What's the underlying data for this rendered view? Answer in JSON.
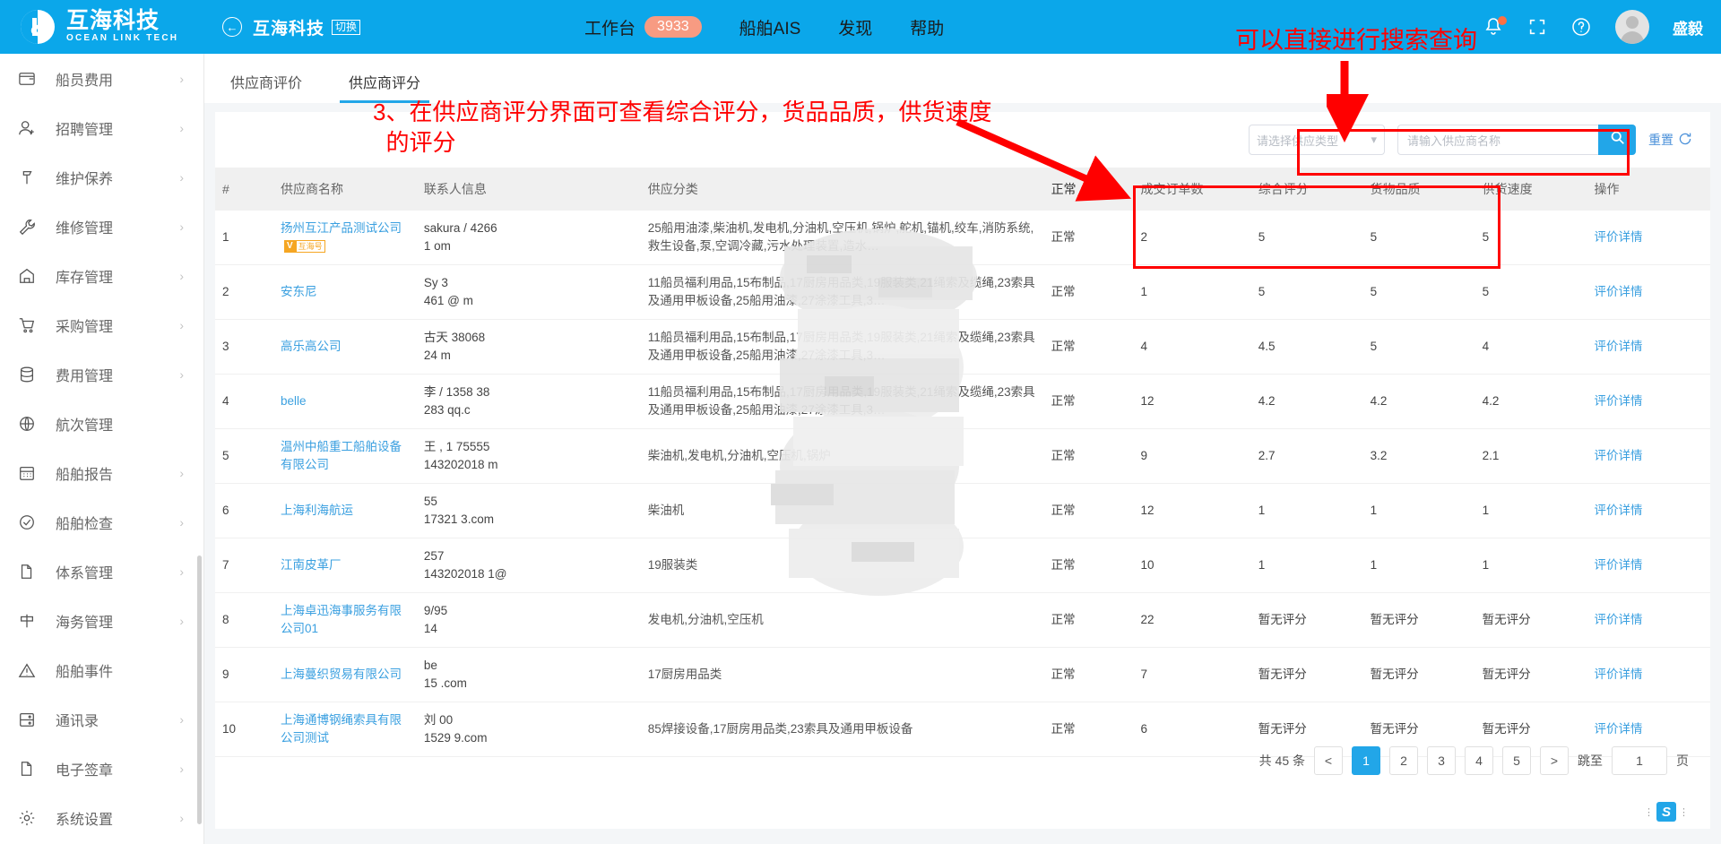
{
  "brand": {
    "cn": "互海科技",
    "en": "OCEAN LINK TECH",
    "sub_title": "互海科技",
    "switch_label": "切换"
  },
  "topnav": {
    "items": [
      {
        "label": "工作台",
        "badge": "3933"
      },
      {
        "label": "船舶AIS",
        "badge": ""
      },
      {
        "label": "发现",
        "badge": ""
      },
      {
        "label": "帮助",
        "badge": ""
      }
    ],
    "username": "盛毅"
  },
  "sidebar": {
    "items": [
      {
        "label": "船员费用",
        "icon": "wallet-icon",
        "arrow": "›"
      },
      {
        "label": "招聘管理",
        "icon": "user-plus-icon",
        "arrow": "›"
      },
      {
        "label": "维护保养",
        "icon": "hammer-icon",
        "arrow": "›"
      },
      {
        "label": "维修管理",
        "icon": "wrench-icon",
        "arrow": "›"
      },
      {
        "label": "库存管理",
        "icon": "home-icon",
        "arrow": "›"
      },
      {
        "label": "采购管理",
        "icon": "cart-icon",
        "arrow": "›"
      },
      {
        "label": "费用管理",
        "icon": "database-icon",
        "arrow": "›"
      },
      {
        "label": "航次管理",
        "icon": "globe-icon",
        "arrow": ""
      },
      {
        "label": "船舶报告",
        "icon": "calendar-icon",
        "arrow": "›"
      },
      {
        "label": "船舶检查",
        "icon": "check-circle-icon",
        "arrow": "›"
      },
      {
        "label": "体系管理",
        "icon": "doc-copy-icon",
        "arrow": "›"
      },
      {
        "label": "海务管理",
        "icon": "signpost-icon",
        "arrow": "›"
      },
      {
        "label": "船舶事件",
        "icon": "warning-icon",
        "arrow": ""
      },
      {
        "label": "通讯录",
        "icon": "contacts-icon",
        "arrow": "›"
      },
      {
        "label": "电子签章",
        "icon": "stamp-doc-icon",
        "arrow": "›"
      },
      {
        "label": "系统设置",
        "icon": "gear-icon",
        "arrow": "›"
      }
    ]
  },
  "tabs": [
    {
      "label": "供应商评价",
      "active": false
    },
    {
      "label": "供应商评分",
      "active": true
    }
  ],
  "filters": {
    "type_placeholder": "请选择供应类型",
    "name_placeholder": "请输入供应商名称",
    "search_icon": "search-icon",
    "reset_label": "重置",
    "reset_icon": "refresh-icon"
  },
  "table": {
    "headers": [
      "#",
      "供应商名称",
      "联系人信息",
      "供应分类",
      "正常",
      "成交订单数",
      "综合评分",
      "货物品质",
      "供货速度",
      "操作"
    ],
    "status_sort_glyph": "▼",
    "rows": [
      {
        "idx": "1",
        "name": "扬州互江产品测试公司",
        "badge_v": "V",
        "badge_text": "互海号",
        "contact_line1": "sakura /          4266",
        "contact_line2": "1                om",
        "category": "25船用油漆,柴油机,发电机,分油机,空压机,锅炉,舵机,锚机,绞车,消防系统,救生设备,泵,空调冷藏,污水处理装置,造水…",
        "status": "正常",
        "orders": "2",
        "overall": "5",
        "quality": "5",
        "speed": "5",
        "action": "评价详情"
      },
      {
        "idx": "2",
        "name": "安东尼",
        "badge_v": "",
        "badge_text": "",
        "contact_line1": "Sy                 3",
        "contact_line2": "461          @     m",
        "category": "11船员福利用品,15布制品,17厨房用品类,19服装类,21绳索及缆绳,23索具及通用甲板设备,25船用油漆,27涂漆工具,3…",
        "status": "正常",
        "orders": "1",
        "overall": "5",
        "quality": "5",
        "speed": "5",
        "action": "评价详情"
      },
      {
        "idx": "3",
        "name": "高乐高公司",
        "badge_v": "",
        "badge_text": "",
        "contact_line1": "古天          38068",
        "contact_line2": "24              m",
        "category": "11船员福利用品,15布制品,17厨房用品类,19服装类,21绳索及缆绳,23索具及通用甲板设备,25船用油漆,27涂漆工具,3…",
        "status": "正常",
        "orders": "4",
        "overall": "4.5",
        "quality": "5",
        "speed": "4",
        "action": "评价详情"
      },
      {
        "idx": "4",
        "name": "belle",
        "badge_v": "",
        "badge_text": "",
        "contact_line1": "李      / 1358      38",
        "contact_line2": "283      qq.c",
        "category": "11船员福利用品,15布制品,17厨房用品类,19服装类,21绳索及缆绳,23索具及通用甲板设备,25船用油漆,27涂漆工具,3…",
        "status": "正常",
        "orders": "12",
        "overall": "4.2",
        "quality": "4.2",
        "speed": "4.2",
        "action": "评价详情"
      },
      {
        "idx": "5",
        "name": "温州中船重工船舶设备有限公司",
        "badge_v": "",
        "badge_text": "",
        "contact_line1": "王      , 1     75555",
        "contact_line2": "143202018        m",
        "category": "柴油机,发电机,分油机,空压机,锅炉",
        "status": "正常",
        "orders": "9",
        "overall": "2.7",
        "quality": "3.2",
        "speed": "2.1",
        "action": "评价详情"
      },
      {
        "idx": "6",
        "name": "上海利海航运",
        "badge_v": "",
        "badge_text": "",
        "contact_line1": "                   55",
        "contact_line2": "17321            3.com",
        "category": "柴油机",
        "status": "正常",
        "orders": "12",
        "overall": "1",
        "quality": "1",
        "speed": "1",
        "action": "评价详情"
      },
      {
        "idx": "7",
        "name": "江南皮革厂",
        "badge_v": "",
        "badge_text": "",
        "contact_line1": "                   257",
        "contact_line2": "143202018 1@",
        "category": "19服装类",
        "status": "正常",
        "orders": "10",
        "overall": "1",
        "quality": "1",
        "speed": "1",
        "action": "评价详情"
      },
      {
        "idx": "8",
        "name": "上海卓迅海事服务有限公司01",
        "badge_v": "",
        "badge_text": "",
        "contact_line1": "                 9/95",
        "contact_line2": "14",
        "category": "发电机,分油机,空压机",
        "status": "正常",
        "orders": "22",
        "overall": "暂无评分",
        "quality": "暂无评分",
        "speed": "暂无评分",
        "action": "评价详情"
      },
      {
        "idx": "9",
        "name": "上海蔓织贸易有限公司",
        "badge_v": "",
        "badge_text": "",
        "contact_line1": "be",
        "contact_line2": "15               .com",
        "category": "17厨房用品类",
        "status": "正常",
        "orders": "7",
        "overall": "暂无评分",
        "quality": "暂无评分",
        "speed": "暂无评分",
        "action": "评价详情"
      },
      {
        "idx": "10",
        "name": "上海通博钢绳索具有限公司测试",
        "badge_v": "",
        "badge_text": "",
        "contact_line1": "刘                 00",
        "contact_line2": "1529           9.com",
        "category": "85焊接设备,17厨房用品类,23索具及通用甲板设备",
        "status": "正常",
        "orders": "6",
        "overall": "暂无评分",
        "quality": "暂无评分",
        "speed": "暂无评分",
        "action": "评价详情"
      }
    ]
  },
  "pagination": {
    "total_label": "共 45 条",
    "prev": "<",
    "pages": [
      "1",
      "2",
      "3",
      "4",
      "5"
    ],
    "active_page": "1",
    "next": ">",
    "jump_label": "跳至",
    "jump_value": "1",
    "page_unit": "页"
  },
  "annotations": {
    "note1": "3、在供应商评分界面可查看综合评分，货品品质，供货速度\n  的评分",
    "note2": "可以直接进行搜索查询"
  },
  "colors": {
    "brand_blue": "#0BA7EA",
    "accent_blue": "#22A6E8",
    "link_blue": "#3ba0e0",
    "annotation_red": "#FF0000",
    "badge_orange": "#F79B82"
  }
}
